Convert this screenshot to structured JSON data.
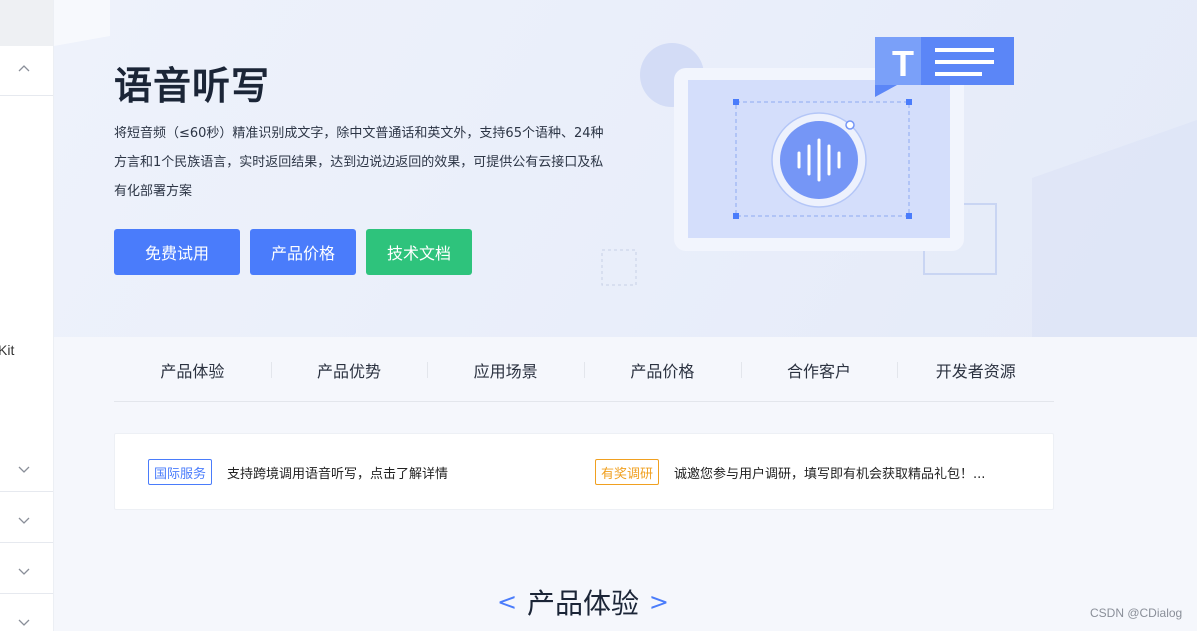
{
  "sidebar": {
    "kit_label": "Kit",
    "chevrons": [
      "chevron-up-icon",
      "chevron-down-icon",
      "chevron-down-icon",
      "chevron-down-icon",
      "chevron-down-icon"
    ]
  },
  "hero": {
    "title": "语音听写",
    "description": "将短音频（≤60秒）精准识别成文字，除中文普通话和英文外，支持65个语种、24种方言和1个民族语言，实时返回结果，达到边说边返回的效果，可提供公有云接口及私有化部署方案",
    "buttons": {
      "trial": "免费试用",
      "price": "产品价格",
      "docs": "技术文档"
    },
    "illustration_icon": "sound-wave-icon",
    "text_icon_letter": "T"
  },
  "tabs": [
    "产品体验",
    "产品优势",
    "应用场景",
    "产品价格",
    "合作客户",
    "开发者资源"
  ],
  "notices": {
    "intl": {
      "badge": "国际服务",
      "text": "支持跨境调用语音听写，点击了解详情"
    },
    "survey": {
      "badge": "有奖调研",
      "text": "诚邀您参与用户调研，填写即有机会获取精品礼包！..."
    }
  },
  "section": {
    "prev": "<",
    "title": "产品体验",
    "next": ">"
  },
  "watermark": "CSDN @CDialog",
  "colors": {
    "primary": "#4a7cfb",
    "green": "#2ec37c",
    "orange": "#f0a020"
  }
}
